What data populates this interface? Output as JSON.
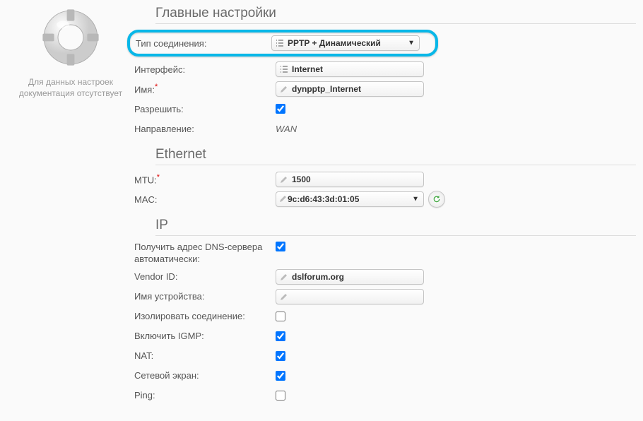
{
  "left": {
    "hint_line1": "Для данных настроек",
    "hint_line2": "документация отсутствует"
  },
  "sections": {
    "main": {
      "title": "Главные настройки",
      "conn_type_label": "Тип соединения:",
      "conn_type_value": "PPTP + Динамический",
      "interface_label": "Интерфейс:",
      "interface_value": "Internet",
      "name_label": "Имя:",
      "name_value": "dynpptp_Internet",
      "allow_label": "Разрешить:",
      "allow_checked": true,
      "direction_label": "Направление:",
      "direction_value": "WAN"
    },
    "ethernet": {
      "title": "Ethernet",
      "mtu_label": "MTU:",
      "mtu_value": "1500",
      "mac_label": "MAC:",
      "mac_value": "9c:d6:43:3d:01:05"
    },
    "ip": {
      "title": "IP",
      "dns_auto_label": "Получить адрес DNS-сервера автоматически:",
      "dns_auto_checked": true,
      "vendor_label": "Vendor ID:",
      "vendor_value": "dslforum.org",
      "devname_label": "Имя устройства:",
      "devname_value": "",
      "isolate_label": "Изолировать соединение:",
      "isolate_checked": false,
      "igmp_label": "Включить IGMP:",
      "igmp_checked": true,
      "nat_label": "NAT:",
      "nat_checked": true,
      "firewall_label": "Сетевой экран:",
      "firewall_checked": true,
      "ping_label": "Ping:",
      "ping_checked": false
    }
  }
}
